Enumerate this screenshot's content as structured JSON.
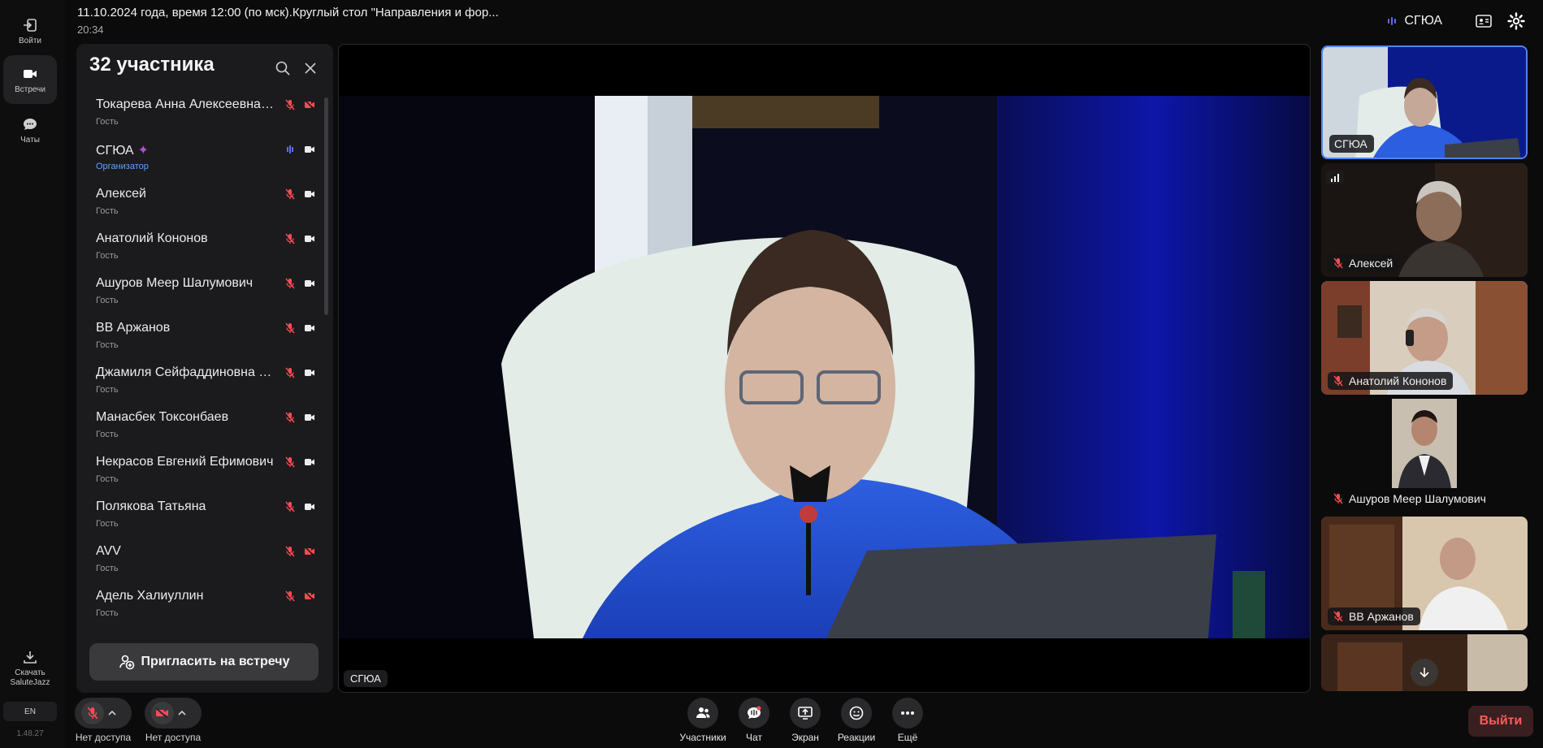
{
  "header": {
    "title": "11.10.2024 года, время 12:00 (по мск).Круглый стол \"Направления и фор...",
    "clock": "20:34",
    "speaker_name": "СГЮА"
  },
  "rail": {
    "login": "Войти",
    "meetings": "Встречи",
    "chats": "Чаты",
    "download": "Скачать SaluteJazz",
    "lang": "EN",
    "version": "1.48.27"
  },
  "panel": {
    "title": "32 участника",
    "invite": "Пригласить на встречу",
    "participants": [
      {
        "name": "Токарева Анна Алексеевна (...",
        "role": "Гость",
        "mic": "off",
        "cam": "off"
      },
      {
        "name": "СГЮА",
        "role": "Организатор",
        "mic": "on",
        "cam": "on"
      },
      {
        "name": "Алексей",
        "role": "Гость",
        "mic": "off",
        "cam": "on"
      },
      {
        "name": "Анатолий Кононов",
        "role": "Гость",
        "mic": "off",
        "cam": "on"
      },
      {
        "name": "Ашуров Меер Шалумович",
        "role": "Гость",
        "mic": "off",
        "cam": "on"
      },
      {
        "name": "ВВ Аржанов",
        "role": "Гость",
        "mic": "off",
        "cam": "on"
      },
      {
        "name": "Джамиля Сейфаддиновна В...",
        "role": "Гость",
        "mic": "off",
        "cam": "on"
      },
      {
        "name": "Манасбек Токсонбаев",
        "role": "Гость",
        "mic": "off",
        "cam": "on"
      },
      {
        "name": "Некрасов Евгений Ефимович",
        "role": "Гость",
        "mic": "off",
        "cam": "on"
      },
      {
        "name": "Полякова Татьяна",
        "role": "Гость",
        "mic": "off",
        "cam": "on"
      },
      {
        "name": "AVV",
        "role": "Гость",
        "mic": "off",
        "cam": "off"
      },
      {
        "name": "Адель Халиуллин",
        "role": "Гость",
        "mic": "off",
        "cam": "off"
      }
    ]
  },
  "main_video": {
    "label": "СГЮА"
  },
  "tiles": [
    {
      "name": "СГЮА"
    },
    {
      "name": "Алексей"
    },
    {
      "name": "Анатолий Кононов"
    },
    {
      "name": "Ашуров Меер Шалумович"
    },
    {
      "name": "ВВ Аржанов"
    }
  ],
  "controls": {
    "mic_caption": "Нет доступа",
    "cam_caption": "Нет доступа",
    "participants": "Участники",
    "chat": "Чат",
    "screen": "Экран",
    "reactions": "Реакции",
    "more": "Ещё",
    "leave": "Выйти"
  },
  "colors": {
    "accent": "#4f83ff",
    "muted": "#ff4b55",
    "organizer": "#5ba4ff"
  }
}
